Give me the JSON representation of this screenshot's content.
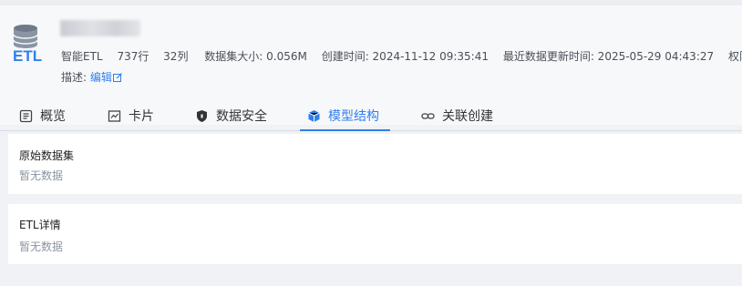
{
  "header": {
    "logo_text": "ETL",
    "meta": {
      "type": "智能ETL",
      "rows": "737行",
      "cols": "32列",
      "size": "数据集大小: 0.056M",
      "created": "创建时间: 2024-11-12 09:35:41",
      "updated": "最近数据更新时间: 2025-05-29 04:43:27",
      "permission": "权限管理"
    },
    "desc_label": "描述:",
    "edit_label": "编辑"
  },
  "tabs": [
    {
      "label": "概览",
      "icon": "document-icon"
    },
    {
      "label": "卡片",
      "icon": "chart-card-icon"
    },
    {
      "label": "数据安全",
      "icon": "shield-icon"
    },
    {
      "label": "模型结构",
      "icon": "cube-icon",
      "active": true
    },
    {
      "label": "关联创建",
      "icon": "link-icon"
    }
  ],
  "sections": {
    "source": {
      "title": "原始数据集",
      "empty": "暂无数据"
    },
    "etl": {
      "title": "ETL详情",
      "empty": "暂无数据"
    }
  },
  "colors": {
    "accent": "#2f80ed",
    "muted": "#8c95a3",
    "background": "#f0f2f5"
  }
}
